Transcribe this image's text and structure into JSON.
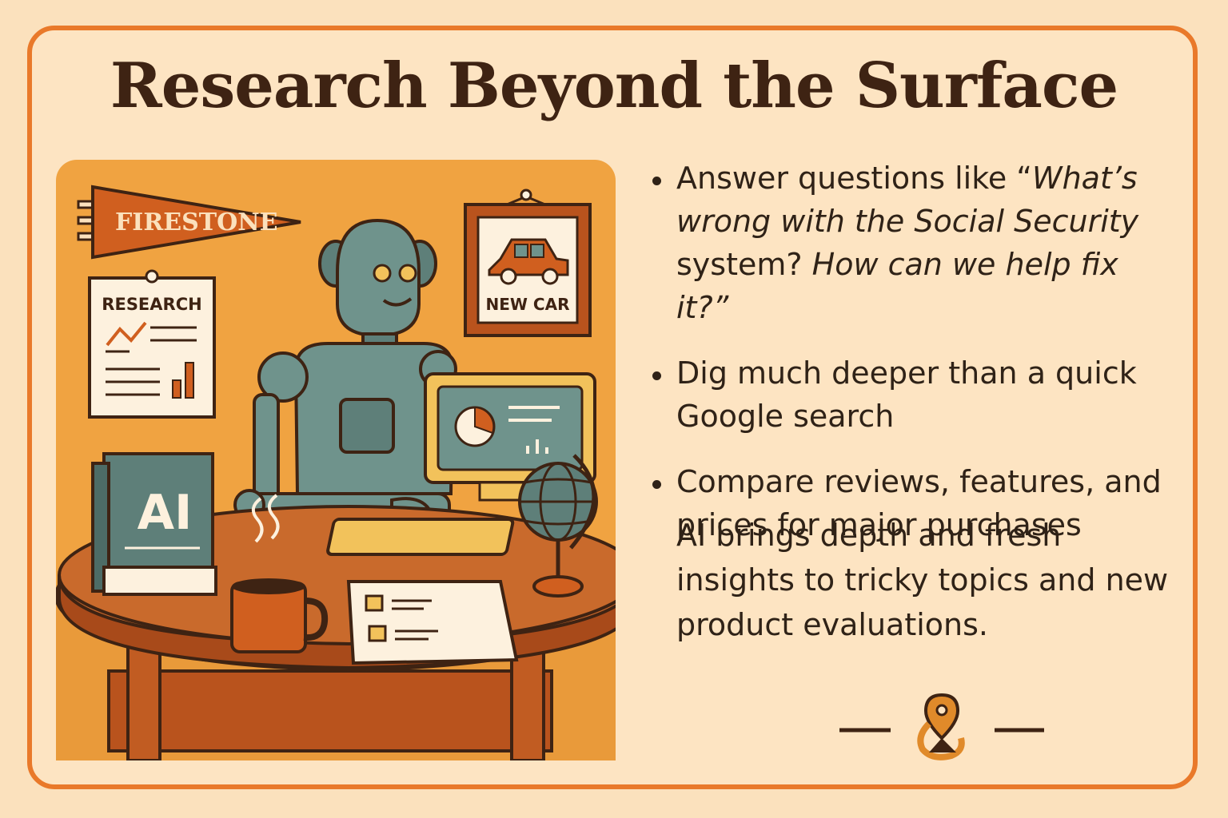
{
  "title": "Research Beyond the Surface",
  "illustration": {
    "pennant_text": "FIRESTONE",
    "clipboard_label": "RESEARCH",
    "frame_label": "NEW CAR",
    "book_label": "AI"
  },
  "bullets": [
    {
      "parts": [
        {
          "text": "Answer questions like “",
          "italic": false
        },
        {
          "text": "What’s wrong with the Social Security",
          "italic": true
        },
        {
          "text": " system? ",
          "italic": false
        },
        {
          "text": "How can we ",
          "italic": true
        },
        {
          "text": "help fix it?”",
          "italic": true
        }
      ]
    },
    {
      "parts": [
        {
          "text": "Dig much deeper than a quick Google search",
          "italic": false
        }
      ]
    },
    {
      "parts": [
        {
          "text": "Compare reviews, features, and prices for major purchases",
          "italic": false
        }
      ]
    }
  ],
  "summary": "AI brings depth and fresh insights to tricky topics and new product evaluations.",
  "colors": {
    "background": "#fde4c2",
    "accent": "#e9792a",
    "robot": "#6f938c",
    "text": "#2f2217"
  }
}
